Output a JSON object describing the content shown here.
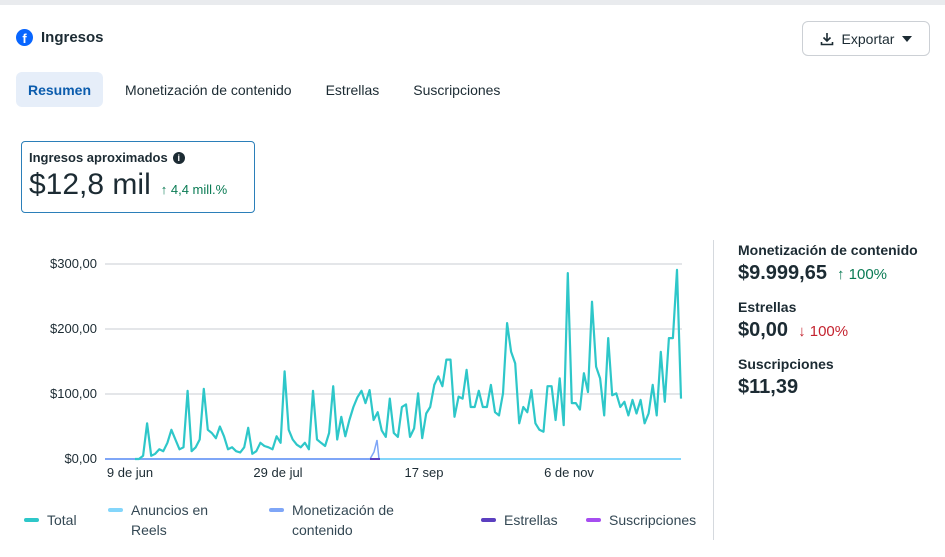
{
  "header": {
    "title": "Ingresos",
    "export_label": "Exportar"
  },
  "tabs": [
    {
      "label": "Resumen",
      "selected": true
    },
    {
      "label": "Monetización de contenido"
    },
    {
      "label": "Estrellas"
    },
    {
      "label": "Suscripciones"
    }
  ],
  "kpi": {
    "label": "Ingresos aproximados",
    "value": "$12,8 mil",
    "change": "4,4 mill.%"
  },
  "side": [
    {
      "label": "Monetización de contenido",
      "value": "$9.999,65",
      "change": "100%",
      "dir": "up"
    },
    {
      "label": "Estrellas",
      "value": "$0,00",
      "change": "100%",
      "dir": "down"
    },
    {
      "label": "Suscripciones",
      "value": "$11,39"
    }
  ],
  "chart_data": {
    "type": "line",
    "yticks": [
      "$300,00",
      "$200,00",
      "$100,00",
      "$0,00"
    ],
    "ylim": [
      0,
      300
    ],
    "xticks": [
      "9 de jun",
      "29 de jul",
      "17 sep",
      "6 de nov"
    ],
    "legend": [
      "Total",
      "Anuncios en Reels",
      "Monetización de contenido",
      "Estrellas",
      "Suscripciones"
    ],
    "colors": {
      "Total": "#2ec7c9",
      "Anuncios en Reels": "#84d6fb",
      "Monetización de contenido": "#7fa6f7",
      "Estrellas": "#5b3fc0",
      "Suscripciones": "#a64df0"
    },
    "total": [
      0,
      0,
      5,
      55,
      5,
      8,
      15,
      12,
      25,
      45,
      30,
      15,
      18,
      105,
      12,
      18,
      30,
      108,
      45,
      40,
      32,
      50,
      35,
      15,
      18,
      12,
      10,
      18,
      48,
      8,
      12,
      25,
      20,
      18,
      15,
      35,
      25,
      135,
      45,
      30,
      22,
      18,
      25,
      15,
      105,
      30,
      25,
      20,
      40,
      112,
      30,
      65,
      35,
      60,
      80,
      95,
      105,
      86,
      106,
      60,
      72,
      44,
      34,
      93,
      40,
      34,
      80,
      84,
      34,
      47,
      101,
      32,
      70,
      80,
      114,
      127,
      112,
      153,
      153,
      65,
      96,
      93,
      137,
      80,
      80,
      105,
      80,
      80,
      114,
      72,
      67,
      101,
      209,
      165,
      147,
      55,
      80,
      72,
      106,
      55,
      45,
      42,
      112,
      112,
      60,
      124,
      52,
      286,
      86,
      86,
      76,
      132,
      103,
      242,
      142,
      124,
      67,
      186,
      98,
      101,
      80,
      88,
      67,
      91,
      70,
      91,
      55,
      70,
      114,
      67,
      165,
      88,
      186,
      186,
      291,
      93
    ]
  }
}
